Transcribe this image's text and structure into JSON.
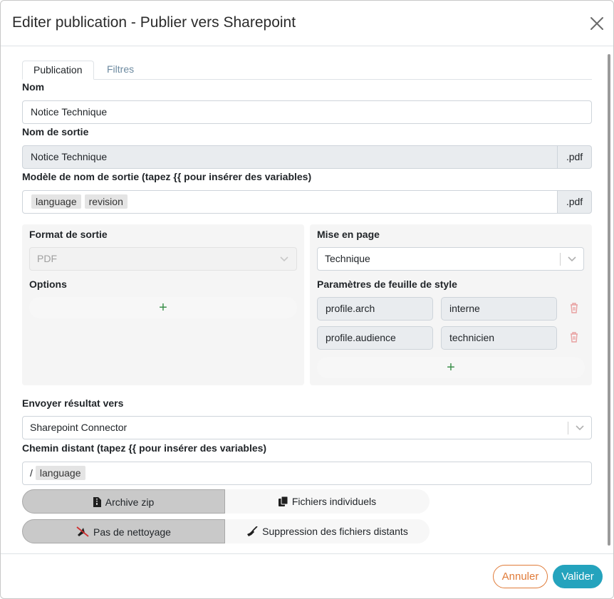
{
  "dialog": {
    "title": "Editer publication - Publier vers Sharepoint"
  },
  "tabs": [
    {
      "label": "Publication",
      "active": true
    },
    {
      "label": "Filtres",
      "active": false
    }
  ],
  "name": {
    "label": "Nom",
    "value": "Notice Technique"
  },
  "output_name": {
    "label": "Nom de sortie",
    "value": "Notice Technique",
    "suffix": ".pdf"
  },
  "output_template": {
    "label": "Modèle de nom de sortie (tapez {{ pour insérer des variables)",
    "chips": [
      "language",
      "revision"
    ],
    "suffix": ".pdf"
  },
  "output_format": {
    "label": "Format de sortie",
    "value": "PDF",
    "disabled": true
  },
  "options": {
    "label": "Options",
    "add_symbol": "+"
  },
  "layout": {
    "label": "Mise en page",
    "value": "Technique"
  },
  "stylesheet_params": {
    "label": "Paramètres de feuille de style",
    "rows": [
      {
        "key": "profile.arch",
        "value": "interne"
      },
      {
        "key": "profile.audience",
        "value": "technicien"
      }
    ],
    "add_symbol": "+"
  },
  "send_to": {
    "label": "Envoyer résultat vers",
    "value": "Sharepoint Connector"
  },
  "remote_path": {
    "label": "Chemin distant (tapez {{ pour insérer des variables)",
    "prefix": "/",
    "chips": [
      "language"
    ]
  },
  "archive_toggle": {
    "option_on": "Archive zip",
    "option_off": "Fichiers individuels",
    "selected": "Archive zip"
  },
  "cleanup_toggle": {
    "option_on": "Pas de nettoyage",
    "option_off": "Suppression des fichiers distants",
    "selected": "Pas de nettoyage"
  },
  "footer": {
    "cancel_label": "Annuler",
    "ok_label": "Valider"
  },
  "colors": {
    "cancel": "#e07b39",
    "ok": "#24a3bd",
    "add": "#3b8f4a",
    "trash": "#e8a0a0"
  },
  "icons": {
    "close": "close-icon",
    "chevron": "chevron-down-icon",
    "trash": "trash-icon",
    "zip": "file-zip-icon",
    "files": "files-icon",
    "no_broom": "broom-off-icon",
    "broom": "broom-icon"
  }
}
